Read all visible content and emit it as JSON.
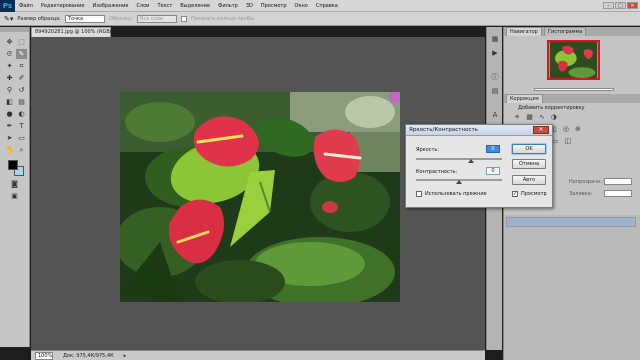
{
  "menubar": {
    "logo": "Ps",
    "items": [
      "Файл",
      "Редактирование",
      "Изображение",
      "Слои",
      "Текст",
      "Выделение",
      "Фильтр",
      "3D",
      "Просмотр",
      "Окно",
      "Справка"
    ],
    "window_controls": [
      "–",
      "□",
      "✕"
    ]
  },
  "options_bar": {
    "sample_size_label": "Размер образца:",
    "sample_size_value": "Точка",
    "sample_label": "Образец:",
    "sample_value": "Все слои",
    "show_ring_label": "Показать кольцо пробы"
  },
  "document": {
    "tab_title": "894920281.jpg @ 100% (RGB/8)",
    "zoom": "100%",
    "doc_info": "Док: 975,4К/975,4К"
  },
  "panels": {
    "navigator_tab": "Навигатор",
    "histogram_tab": "Гистограмма",
    "adjustments_tab": "Коррекция",
    "add_adjustment_label": "Добавить корректировку",
    "layers_labels": {
      "opacity_label": "Непрозрачн.:",
      "fill_label": "Заливка:"
    }
  },
  "dialog": {
    "title": "Яркость/Контрастность",
    "close": "✕",
    "brightness_label": "Яркость:",
    "brightness_value": "0",
    "contrast_label": "Контрастность:",
    "contrast_value": "0",
    "use_legacy_label": "Использовать прежние",
    "use_legacy_checked": false,
    "preview_label": "Просмотр",
    "preview_checked": true,
    "ok_label": "OK",
    "cancel_label": "Отмена",
    "auto_label": "Авто"
  },
  "colors": {
    "foreground": "#000000",
    "background": "#a8d8e8",
    "accent_close": "#c94c3c"
  },
  "icons": {
    "tools": [
      "move-icon",
      "marquee-icon",
      "lasso-icon",
      "quick-select-icon",
      "crop-icon",
      "eyedropper-icon",
      "healing-icon",
      "brush-icon",
      "clone-stamp-icon",
      "history-brush-icon",
      "eraser-icon",
      "gradient-icon",
      "blur-icon",
      "dodge-icon",
      "pen-icon",
      "type-icon",
      "path-select-icon",
      "shape-icon",
      "hand-icon",
      "zoom-icon"
    ]
  }
}
